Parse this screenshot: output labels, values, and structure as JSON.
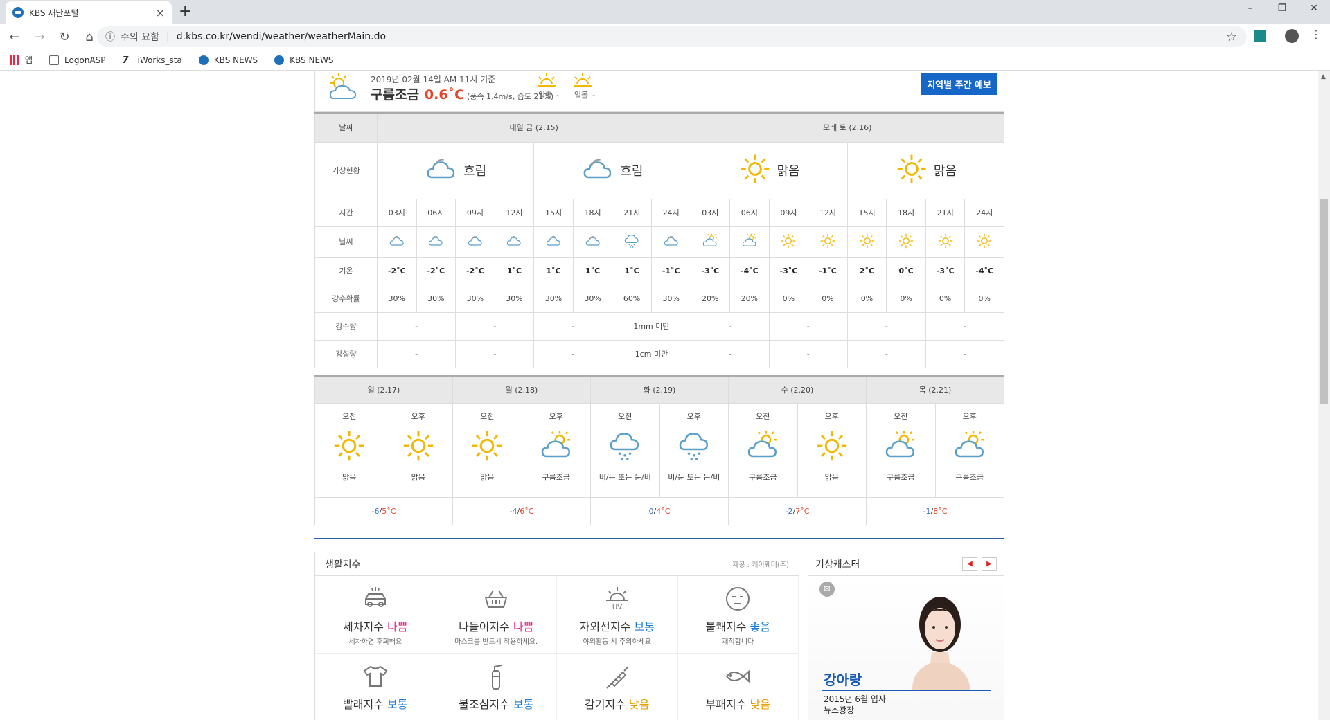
{
  "browser": {
    "tab_title": "KBS 재난포털",
    "url_warning": "주의 요함",
    "url": "d.kbs.co.kr/wendi/weather/weatherMain.do",
    "bookmarks": [
      "앱",
      "LogonASP",
      "iWorks_sta",
      "KBS NEWS",
      "KBS NEWS"
    ]
  },
  "current": {
    "datetime": "2019년 02월 14일 AM 11시 기준",
    "condition": "구름조금",
    "temp": "0.6˚C",
    "detail": "(풍속 1.4m/s, 습도 21%)",
    "sunrise_label": "일출",
    "sunrise_value": "-",
    "sunset_label": "일몰",
    "sunset_value": "-",
    "weekly_button": "지역별 주간 예보"
  },
  "forecast": {
    "header_date_label": "날짜",
    "day1_label": "내일 금 (2.15)",
    "day2_label": "모레 토 (2.16)",
    "row_labels": {
      "status": "기상현황",
      "time": "시간",
      "weather": "날씨",
      "temp": "기온",
      "pop": "강수확률",
      "rain": "강수량",
      "snow": "강설량"
    },
    "status": [
      {
        "icon": "cloud-icon",
        "text": "흐림"
      },
      {
        "icon": "cloud-icon",
        "text": "흐림"
      },
      {
        "icon": "sun-icon",
        "text": "맑음"
      },
      {
        "icon": "sun-icon",
        "text": "맑음"
      }
    ],
    "hours": [
      {
        "time": "03시",
        "icon": "cloud",
        "temp": "-2˚C",
        "pop": "30%"
      },
      {
        "time": "06시",
        "icon": "cloud",
        "temp": "-2˚C",
        "pop": "30%"
      },
      {
        "time": "09시",
        "icon": "cloud",
        "temp": "-2˚C",
        "pop": "30%"
      },
      {
        "time": "12시",
        "icon": "cloud",
        "temp": "1˚C",
        "pop": "30%"
      },
      {
        "time": "15시",
        "icon": "cloud",
        "temp": "1˚C",
        "pop": "30%"
      },
      {
        "time": "18시",
        "icon": "cloud",
        "temp": "1˚C",
        "pop": "30%"
      },
      {
        "time": "21시",
        "icon": "cloud-snow",
        "temp": "1˚C",
        "pop": "60%"
      },
      {
        "time": "24시",
        "icon": "cloud",
        "temp": "-1˚C",
        "pop": "30%"
      },
      {
        "time": "03시",
        "icon": "partly",
        "temp": "-3˚C",
        "pop": "20%"
      },
      {
        "time": "06시",
        "icon": "partly",
        "temp": "-4˚C",
        "pop": "20%"
      },
      {
        "time": "09시",
        "icon": "sun",
        "temp": "-3˚C",
        "pop": "0%"
      },
      {
        "time": "12시",
        "icon": "sun",
        "temp": "-1˚C",
        "pop": "0%"
      },
      {
        "time": "15시",
        "icon": "sun",
        "temp": "2˚C",
        "pop": "0%"
      },
      {
        "time": "18시",
        "icon": "sun",
        "temp": "0˚C",
        "pop": "0%"
      },
      {
        "time": "21시",
        "icon": "sun",
        "temp": "-3˚C",
        "pop": "0%"
      },
      {
        "time": "24시",
        "icon": "sun",
        "temp": "-4˚C",
        "pop": "0%"
      }
    ],
    "rain": [
      "-",
      "-",
      "-",
      "1mm 미만",
      "-",
      "-",
      "-",
      "-"
    ],
    "snow": [
      "-",
      "-",
      "-",
      "1cm 미만",
      "-",
      "-",
      "-",
      "-"
    ]
  },
  "weekly": [
    {
      "day": "일 (2.17)",
      "am_label": "오전",
      "pm_label": "오후",
      "am_icon": "sun",
      "pm_icon": "sun",
      "am_cond": "맑음",
      "pm_cond": "맑음",
      "tmin": "-6",
      "tmax": "5˚C"
    },
    {
      "day": "월 (2.18)",
      "am_label": "오전",
      "pm_label": "오후",
      "am_icon": "sun",
      "pm_icon": "partly",
      "am_cond": "맑음",
      "pm_cond": "구름조금",
      "tmin": "-4",
      "tmax": "6˚C"
    },
    {
      "day": "화 (2.19)",
      "am_label": "오전",
      "pm_label": "오후",
      "am_icon": "cloud-snow",
      "pm_icon": "cloud-snow",
      "am_cond": "비/눈 또는 눈/비",
      "pm_cond": "비/눈 또는 눈/비",
      "tmin": "0",
      "tmax": "4˚C"
    },
    {
      "day": "수 (2.20)",
      "am_label": "오전",
      "pm_label": "오후",
      "am_icon": "partly",
      "pm_icon": "sun",
      "am_cond": "구름조금",
      "pm_cond": "맑음",
      "tmin": "-2",
      "tmax": "7˚C"
    },
    {
      "day": "목 (2.21)",
      "am_label": "오전",
      "pm_label": "오후",
      "am_icon": "partly",
      "pm_icon": "partly",
      "am_cond": "구름조금",
      "pm_cond": "구름조금",
      "tmin": "-1",
      "tmax": "8˚C"
    }
  ],
  "life": {
    "title": "생활지수",
    "source": "제공 : 케이웨더(주)",
    "items": [
      {
        "icon": "car-icon",
        "name": "세차지수",
        "level": "나쁨",
        "level_class": "bad",
        "desc": "세차하면 후회해요"
      },
      {
        "icon": "basket-icon",
        "name": "나들이지수",
        "level": "나쁨",
        "level_class": "bad",
        "desc": "마스크를 반드시 착용하세요."
      },
      {
        "icon": "uv-icon",
        "name": "자외선지수",
        "level": "보통",
        "level_class": "norm",
        "desc": "야외활동 시 주의하세요"
      },
      {
        "icon": "face-icon",
        "name": "불쾌지수",
        "level": "좋음",
        "level_class": "good",
        "desc": "쾌적합니다"
      },
      {
        "icon": "shirt-icon",
        "name": "빨래지수",
        "level": "보통",
        "level_class": "norm",
        "desc": ""
      },
      {
        "icon": "extinguisher-icon",
        "name": "불조심지수",
        "level": "보통",
        "level_class": "norm",
        "desc": ""
      },
      {
        "icon": "syringe-icon",
        "name": "감기지수",
        "level": "낮음",
        "level_class": "low",
        "desc": ""
      },
      {
        "icon": "fish-icon",
        "name": "부패지수",
        "level": "낮음",
        "level_class": "low",
        "desc": ""
      }
    ]
  },
  "caster": {
    "title": "기상캐스터",
    "name": "강아랑",
    "info1": "2015년 6월 입사",
    "info2": "뉴스광장"
  }
}
